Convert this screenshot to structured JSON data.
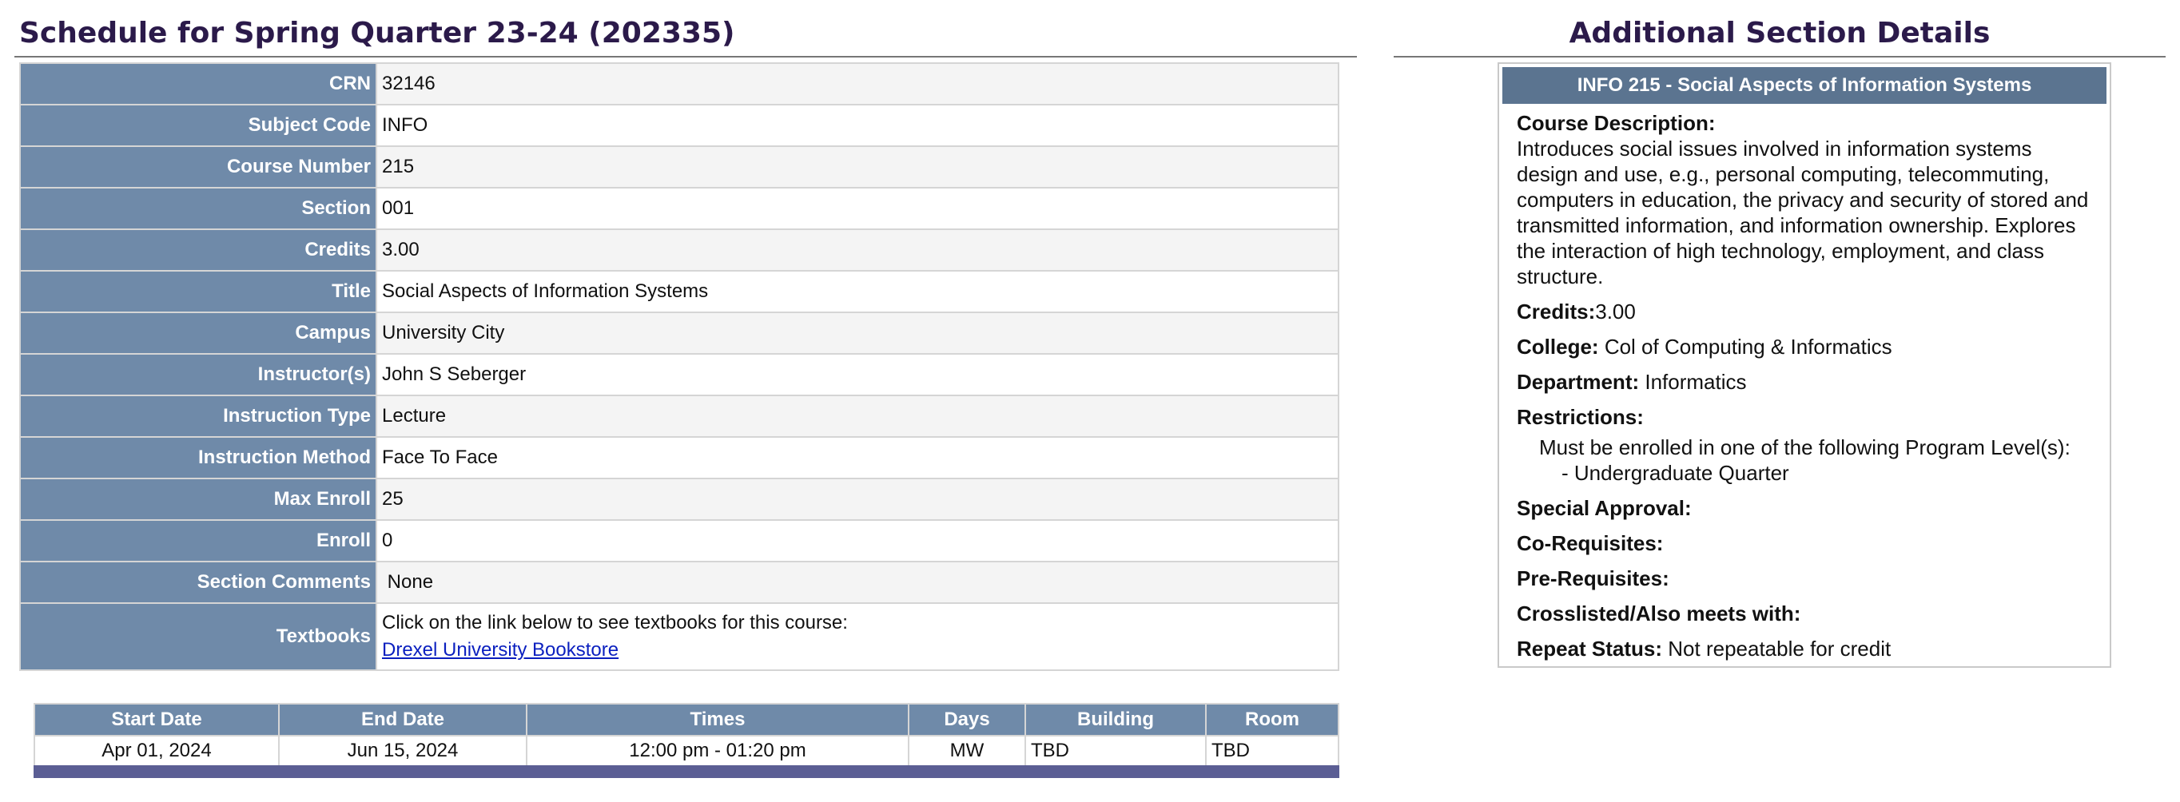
{
  "schedule": {
    "title": "Schedule for Spring Quarter 23-24 (202335)",
    "rows": [
      {
        "label": "CRN",
        "value": "32146"
      },
      {
        "label": "Subject Code",
        "value": "INFO"
      },
      {
        "label": "Course Number",
        "value": "215"
      },
      {
        "label": "Section",
        "value": "001"
      },
      {
        "label": "Credits",
        "value": "3.00"
      },
      {
        "label": "Title",
        "value": "Social Aspects of Information Systems"
      },
      {
        "label": "Campus",
        "value": "University City"
      },
      {
        "label": "Instructor(s)",
        "value": "John S Seberger"
      },
      {
        "label": "Instruction Type",
        "value": "Lecture"
      },
      {
        "label": "Instruction Method",
        "value": "Face To Face"
      },
      {
        "label": "Max Enroll",
        "value": "25"
      },
      {
        "label": "Enroll",
        "value": "0"
      },
      {
        "label": "Section Comments",
        "value": "None"
      }
    ],
    "textbooks": {
      "label": "Textbooks",
      "text": "Click on the link below to see textbooks for this course:",
      "link": "Drexel University Bookstore"
    },
    "meeting": {
      "headers": [
        "Start Date",
        "End Date",
        "Times",
        "Days",
        "Building",
        "Room"
      ],
      "row": [
        "Apr 01, 2024",
        "Jun 15, 2024",
        "12:00 pm - 01:20 pm",
        "MW",
        "TBD",
        "TBD"
      ]
    }
  },
  "details": {
    "title": "Additional Section Details",
    "header": "INFO 215 - Social Aspects of Information Systems",
    "description_label": "Course Description:",
    "description": "Introduces social issues involved in information systems design and use, e.g., personal computing, telecommuting, computers in education, the privacy and security of stored and transmitted information, and information ownership. Explores the interaction of high technology, employment, and class structure.",
    "credits_label": "Credits:",
    "credits": "3.00",
    "college_label": "College:",
    "college": "Col of Computing & Informatics",
    "department_label": "Department:",
    "department": "Informatics",
    "restrictions_label": "Restrictions:",
    "restrictions_line": "Must be enrolled in one of the following Program Level(s):",
    "restrictions_sub": "- Undergraduate Quarter",
    "special_approval_label": "Special Approval:",
    "corequisites_label": "Co-Requisites:",
    "prerequisites_label": "Pre-Requisites:",
    "crosslisted_label": "Crosslisted/Also meets with:",
    "repeat_label": "Repeat Status:",
    "repeat": "Not repeatable for credit"
  },
  "colors": {
    "title_text": "#2b1a4a",
    "label_bg": "#6f8aa9",
    "details_header_bg": "#5b7490",
    "footer_bar": "#5b5e94",
    "link": "#0a1fbf"
  }
}
